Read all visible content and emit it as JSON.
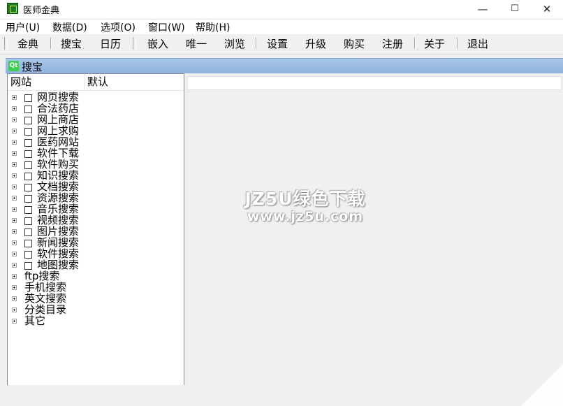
{
  "window": {
    "title": "医师金典",
    "controls": {
      "minimize": "—",
      "maximize": "☐",
      "close": "✕"
    }
  },
  "menubar": [
    "用户(U)",
    "数据(D)",
    "选项(O)",
    "窗口(W)",
    "帮助(H)"
  ],
  "toolbar": {
    "group1": [
      "金典",
      "搜宝",
      "日历"
    ],
    "group2": [
      "嵌入",
      "唯一",
      "浏览",
      "设置",
      "升级",
      "购买",
      "注册",
      "关于",
      "退出"
    ]
  },
  "dock": {
    "icon_text": "Qt",
    "title": "搜宝"
  },
  "tree": {
    "columns": [
      "网站",
      "默认"
    ],
    "checked_items": [
      "网页搜索",
      "合法药店",
      "网上商店",
      "网上求购",
      "医药网站",
      "软件下载",
      "软件购买",
      "知识搜索",
      "文档搜索",
      "资源搜索",
      "音乐搜索",
      "视频搜索",
      "图片搜索",
      "新闻搜索",
      "软件搜索",
      "地图搜索"
    ],
    "plain_items": [
      "ftp搜索",
      "手机搜索",
      "英文搜索",
      "分类目录",
      "其它"
    ]
  },
  "watermark": {
    "line1": "JZ5U绿色下载",
    "line2": "www.jz5u.com"
  },
  "icons": {
    "app": "app-icon",
    "qt": "qt-logo-icon",
    "expander": "plus-expander-icon"
  }
}
